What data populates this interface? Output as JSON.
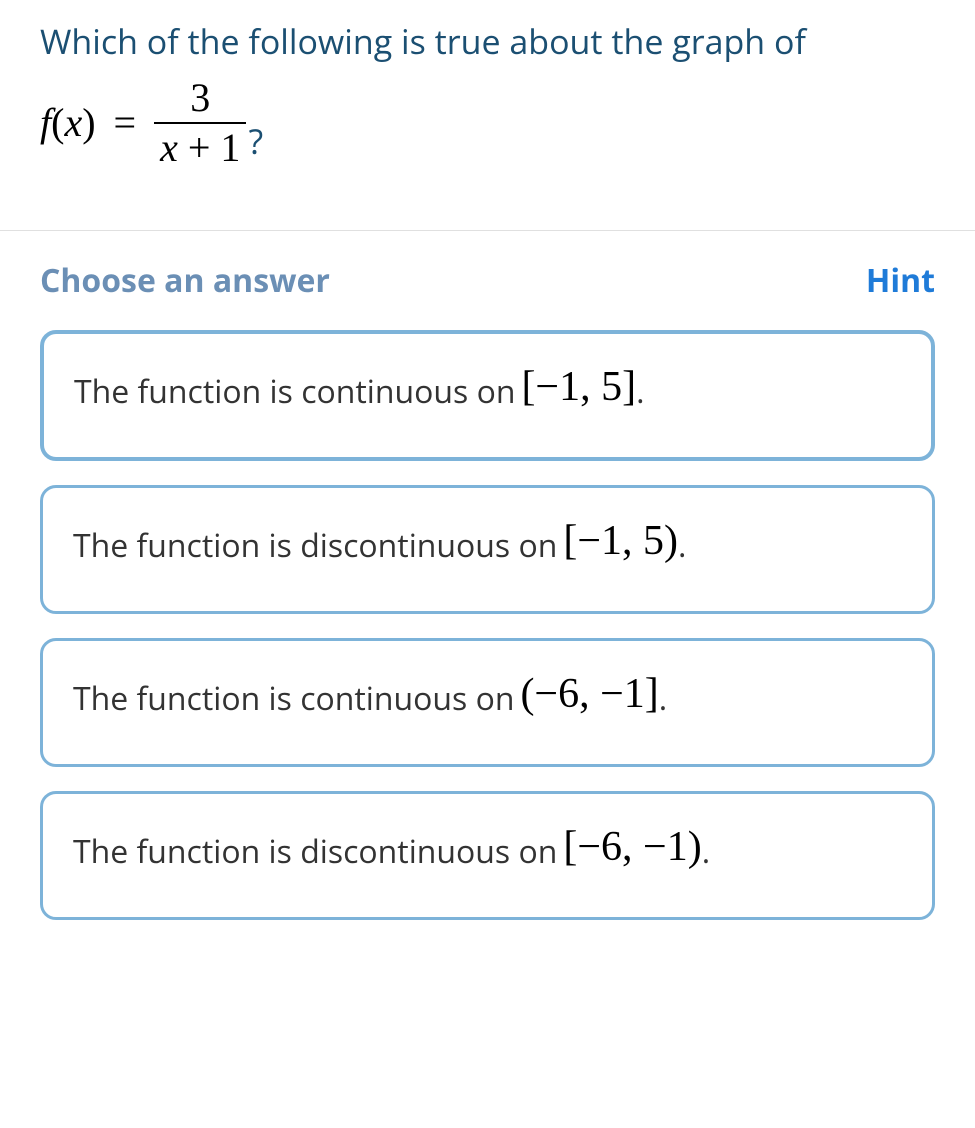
{
  "question": {
    "prompt": "Which of the following is true about the graph of",
    "formula": {
      "lhs": "f(x)",
      "equals": "=",
      "numerator": "3",
      "denominator_x": "x",
      "denominator_rest": " + 1"
    },
    "qmark": "?"
  },
  "answer_header": {
    "choose": "Choose an answer",
    "hint": "Hint"
  },
  "choices": [
    {
      "text": "The function is continuous on ",
      "interval": "[−1, 5]",
      "period": "."
    },
    {
      "text": "The function is discontinuous on ",
      "interval": "[−1, 5)",
      "period": "."
    },
    {
      "text": "The function is continuous on ",
      "interval": "(−6, −1]",
      "period": "."
    },
    {
      "text": "The function is discontinuous on ",
      "interval": "[−6, −1)",
      "period": "."
    }
  ]
}
